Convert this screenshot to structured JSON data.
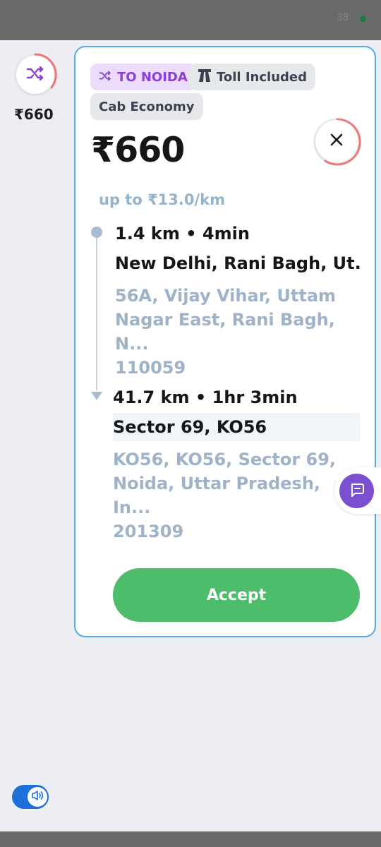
{
  "status_bar": {
    "indicator_text": "38"
  },
  "mini_tile": {
    "price": "₹660"
  },
  "card": {
    "destination_chip": "TO NOIDA",
    "toll_chip": "Toll Included",
    "category_chip": "Cab Economy",
    "price": "₹660",
    "rate": "up to ₹13.0/km",
    "pickup": {
      "distance_time": "1.4 km • 4min",
      "title": "New Delhi, Rani Bagh, Ut...",
      "address_line1": "56A, Vijay Vihar, Uttam",
      "address_line2": "Nagar East, Rani Bagh, N...",
      "address_line3": "110059"
    },
    "drop": {
      "distance_time": "41.7 km • 1hr 3min",
      "title": "Sector 69, KO56",
      "address_line1": "KO56, KO56, Sector 69,",
      "address_line2": "Noida, Uttar Pradesh, In...",
      "address_line3": "201309"
    },
    "accept_label": "Accept"
  },
  "colors": {
    "accent_purple": "#8a3fd6",
    "accept_green": "#4dbc6b",
    "card_border": "#5aa9e6",
    "timer_ring": "#f07a7a",
    "toggle_blue": "#1e6fd9"
  },
  "icons": {
    "shuffle": "shuffle-icon",
    "highway": "highway-icon",
    "close": "close-icon",
    "chat": "chat-icon",
    "speaker": "speaker-icon"
  }
}
